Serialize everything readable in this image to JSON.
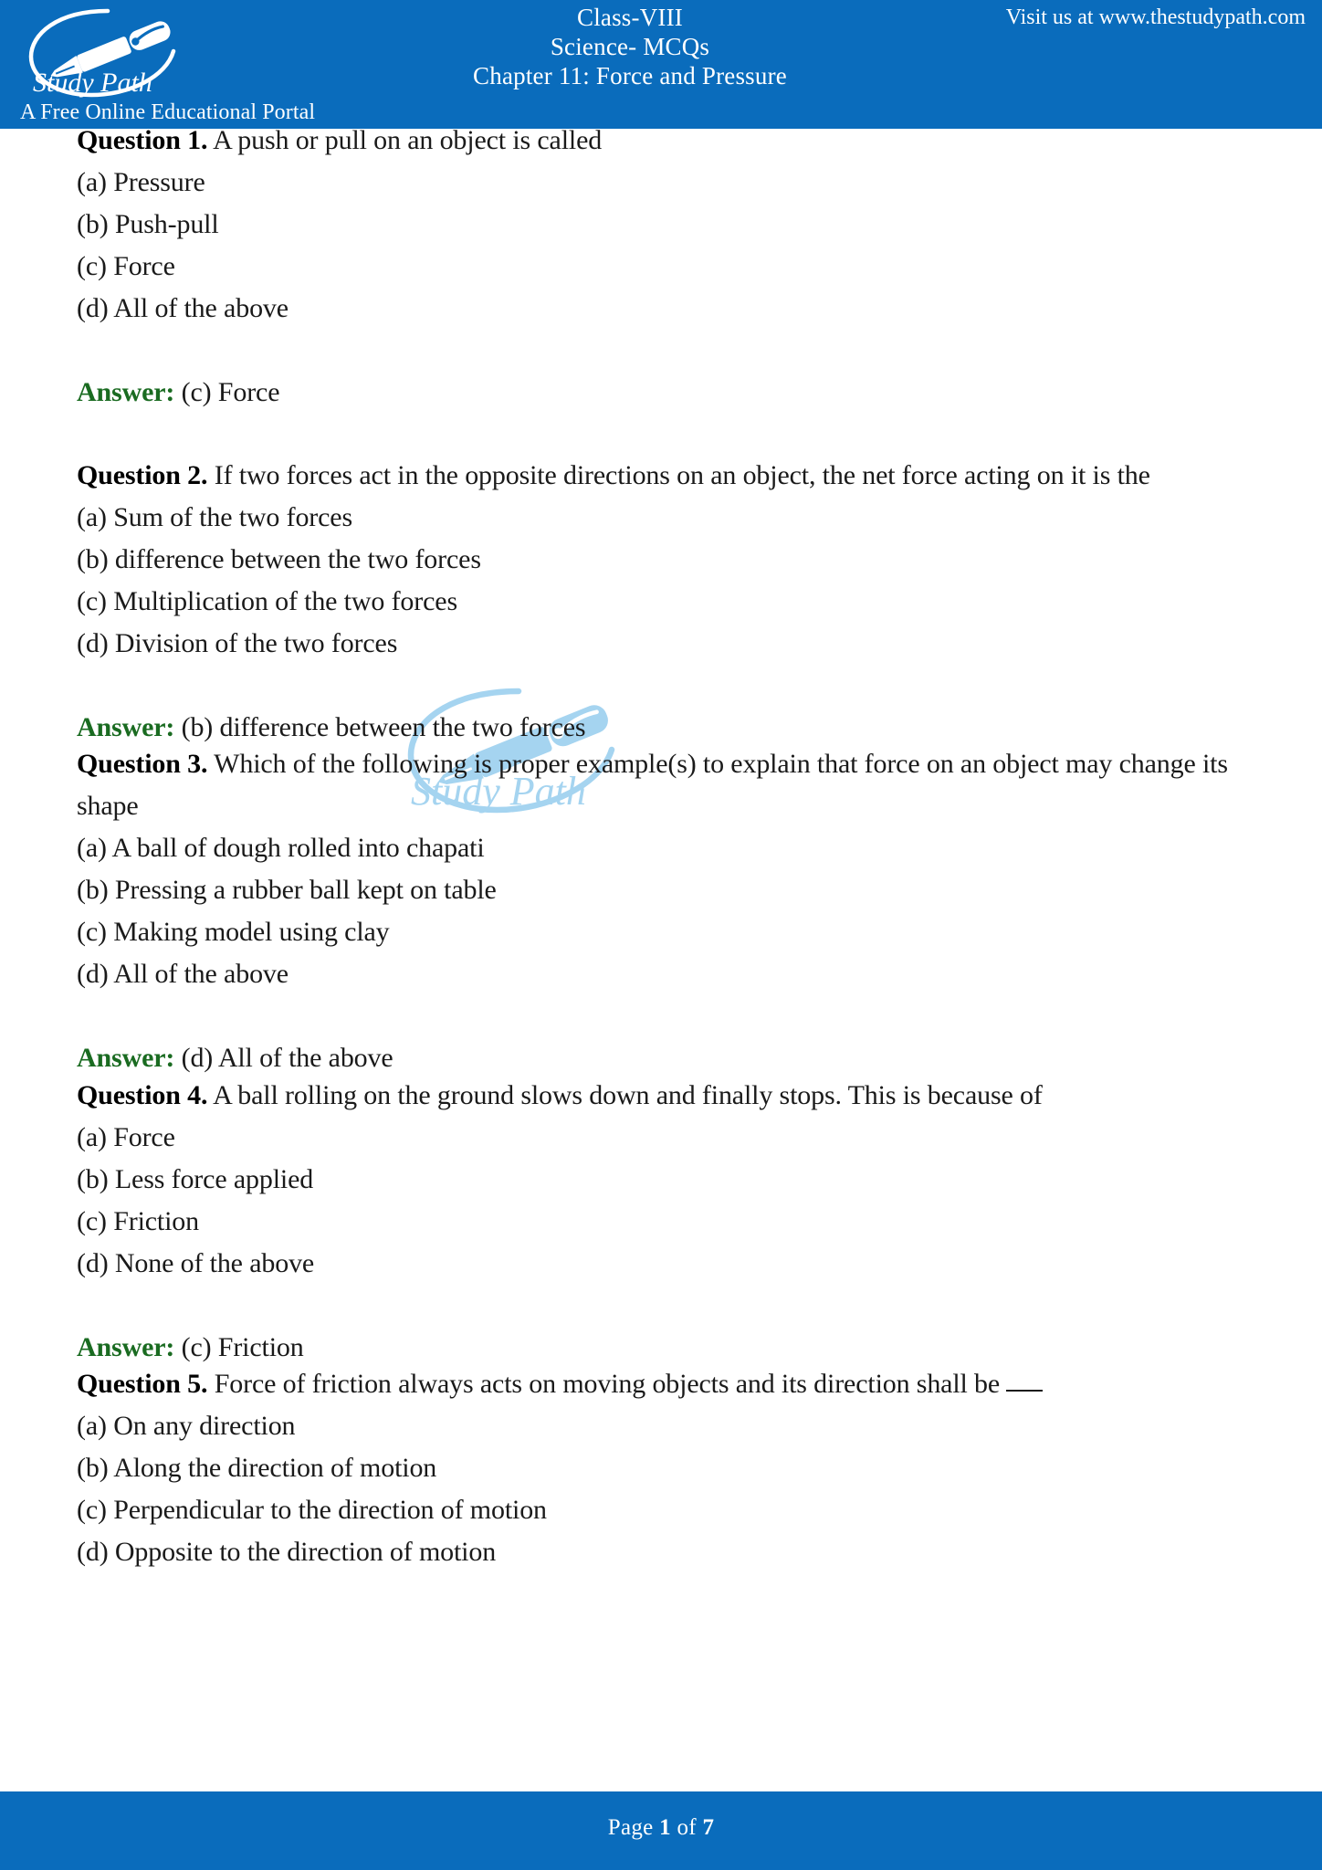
{
  "theme": {
    "band_blue": "#0a6cbc",
    "answer_green": "#1a6b21",
    "watermark_blue": "#a5d4f0",
    "body_text": "#1a1a1a"
  },
  "header": {
    "logo_name": "Study Path",
    "logo_tagline": "A Free Online Educational Portal",
    "logo_icon": "fountain-pen-icon",
    "title_line1": "Class-VIII",
    "title_line2": "Science- MCQs",
    "title_line3": "Chapter 11: Force and Pressure",
    "visit_text": "Visit us at www.thestudypath.com"
  },
  "watermark": {
    "text": "Study Path",
    "icon": "fountain-pen-icon"
  },
  "answer_prefix": "Answer:",
  "questions": [
    {
      "label": "Question 1.",
      "text": " A push or pull on an object is called",
      "options": [
        "(a) Pressure",
        "(b) Push-pull",
        "(c) Force",
        "(d) All of the above"
      ],
      "answer": " (c) Force"
    },
    {
      "label": "Question 2.",
      "text": "  If two forces act in the opposite directions on an object, the net force acting on it is the",
      "options": [
        "(a) Sum of the two forces",
        "(b) difference between the two forces",
        "(c) Multiplication of the two forces",
        "(d) Division of the two forces"
      ],
      "answer": " (b) difference between the two forces"
    },
    {
      "label": "Question 3.",
      "text": " Which of the following is proper example(s) to explain that force on an object may change its shape",
      "options": [
        "(a) A ball of dough rolled into chapati",
        "(b) Pressing a rubber ball kept on table",
        "(c) Making model using clay",
        "(d) All of the above"
      ],
      "answer": " (d) All of the above"
    },
    {
      "label": "Question 4.",
      "text": " A ball rolling on the ground slows down and finally stops. This is because of",
      "options": [
        "(a) Force",
        "(b) Less force applied",
        "(c) Friction",
        "(d) None of the above"
      ],
      "answer": " (c) Friction"
    },
    {
      "label": "Question 5.",
      "text": " Force of friction always acts on moving objects and its direction shall be ",
      "blank": "___",
      "options": [
        "(a) On any direction",
        "(b) Along the direction of motion",
        "(c) Perpendicular to the direction of motion",
        "(d) Opposite to the direction of motion"
      ]
    }
  ],
  "footer": {
    "page_prefix": "Page ",
    "page_number": "1",
    "page_middle": " of ",
    "page_total": "7"
  }
}
